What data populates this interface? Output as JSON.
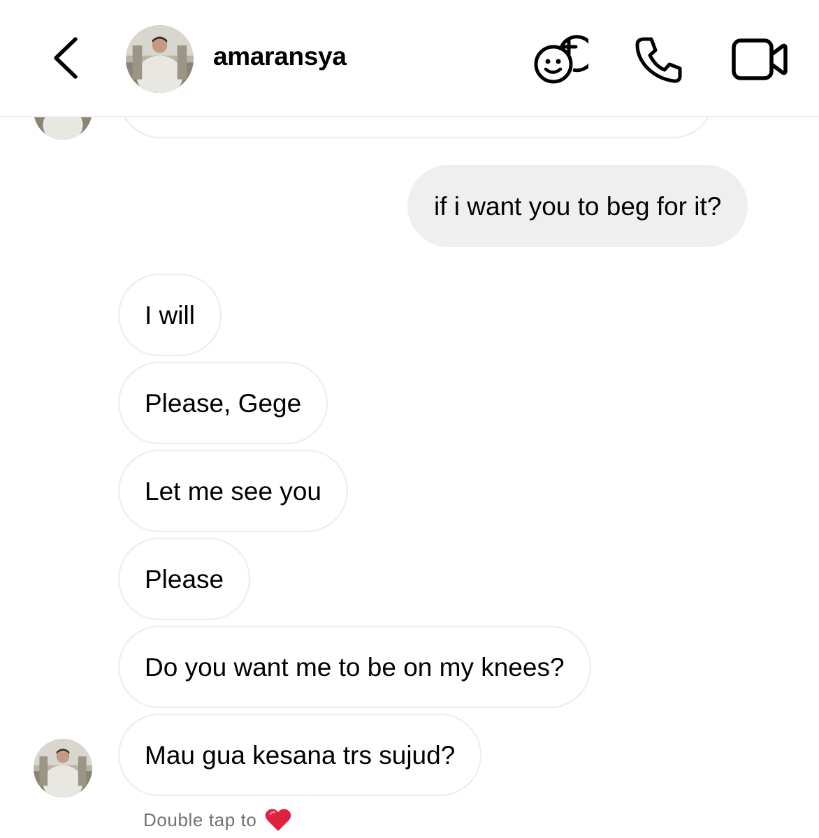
{
  "header": {
    "username": "amaransya",
    "icons": {
      "back": "chevron-left-icon",
      "effects": "stickers-effects-icon",
      "call": "phone-icon",
      "video": "video-camera-icon"
    }
  },
  "colors": {
    "incoming_bubble_border": "#ececec",
    "outgoing_bubble_bg": "#efefef",
    "heart": "#e0213d",
    "muted_text": "#737373"
  },
  "messages": [
    {
      "direction": "outgoing",
      "text": "if i want you to beg for it?"
    },
    {
      "direction": "incoming",
      "text": "I will"
    },
    {
      "direction": "incoming",
      "text": "Please, Gege"
    },
    {
      "direction": "incoming",
      "text": "Let me see you"
    },
    {
      "direction": "incoming",
      "text": "Please"
    },
    {
      "direction": "incoming",
      "text": "Do you want me to be on my knees?"
    },
    {
      "direction": "incoming",
      "text": "Mau gua kesana trs sujud?"
    }
  ],
  "footer": {
    "double_tap_text": "Double tap to",
    "reaction_icon": "red-heart-icon"
  }
}
